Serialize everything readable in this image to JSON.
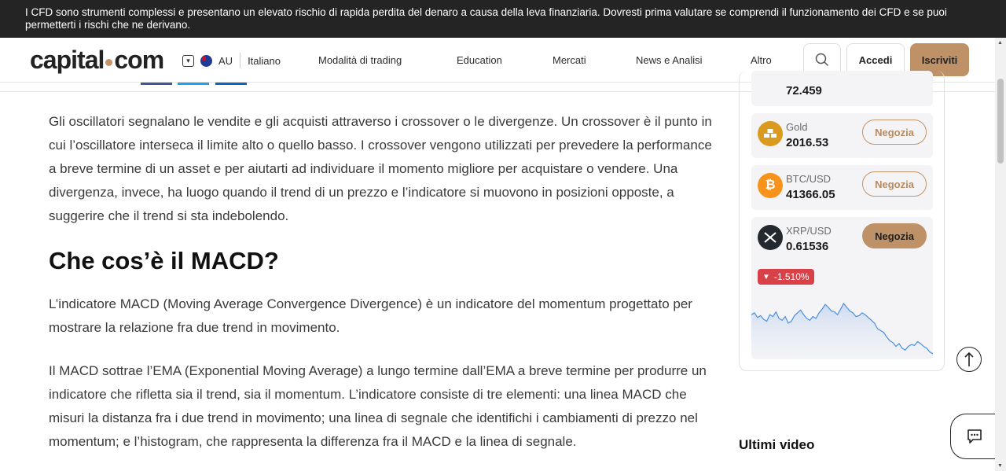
{
  "risk_banner": {
    "text": "I CFD sono strumenti complessi e presentano un elevato rischio di rapida perdita del denaro a causa della leva finanziaria. Dovresti prima valutare se comprendi il funzionamento dei CFD e se puoi permetterti i rischi che ne derivano."
  },
  "header": {
    "logo_left": "capital",
    "logo_right": "com",
    "region_code": "AU",
    "language": "Italiano",
    "nav": [
      "Modalità di trading",
      "Education",
      "Mercati",
      "News e Analisi",
      "Altro"
    ],
    "login_label": "Accedi",
    "signup_label": "Iscriviti"
  },
  "article": {
    "paragraph_1": "Gli oscillatori segnalano le vendite e gli acquisti attraverso i crossover o le divergenze. Un crossover è il punto in cui l’oscillatore interseca il limite alto o quello basso. I crossover vengono utilizzati per prevedere la performance a breve termine di un asset e per aiutarti ad individuare il momento migliore per acquistare o vendere. Una divergenza, invece, ha luogo quando il trend di un prezzo e l’indicatore si muovono in posizioni opposte, a suggerire che il trend si sta indebolendo.",
    "heading": "Che cos’è il MACD?",
    "paragraph_2": "L’indicatore MACD (Moving Average Convergence Divergence) è un indicatore del momentum progettato per mostrare la relazione fra due trend in movimento.",
    "paragraph_3": "Il MACD sottrae l’EMA (Exponential Moving Average) a lungo termine dall’EMA a breve termine per produrre un indicatore che rifletta sia il trend, sia il momentum. L’indicatore consiste di tre elementi: una linea MACD che misuri la distanza fra i due trend in movimento; una linea di segnale che identifichi i cambiamenti di prezzo nel momentum; e l’histogram, che rappresenta la differenza fra il MACD e la linea di segnale."
  },
  "sidebar": {
    "partial_price": "72.459",
    "assets": [
      {
        "name": "Gold",
        "price": "2016.53",
        "trade_label": "Negozia",
        "icon": "gold-bars-icon",
        "color": "#d99a1e"
      },
      {
        "name": "BTC/USD",
        "price": "41366.05",
        "trade_label": "Negozia",
        "icon": "bitcoin-icon",
        "color": "#f7931a"
      },
      {
        "name": "XRP/USD",
        "price": "0.61536",
        "trade_label": "Negozia",
        "icon": "xrp-icon",
        "color": "#23292f",
        "change": "-1.510%"
      }
    ],
    "videos_title": "Ultimi video"
  },
  "colors": {
    "accent": "#bf9167",
    "banner_bg": "#242424",
    "negative": "#d84148",
    "sparkline": "#4a8fe0"
  },
  "sparkline_values": [
    64,
    66,
    61,
    63,
    59,
    57,
    64,
    62,
    67,
    60,
    58,
    62,
    55,
    57,
    63,
    66,
    69,
    64,
    60,
    58,
    62,
    60,
    66,
    70,
    75,
    72,
    68,
    67,
    64,
    70,
    76,
    72,
    68,
    66,
    62,
    63,
    66,
    64,
    61,
    58,
    55,
    49,
    47,
    45,
    40,
    36,
    34,
    30,
    33,
    28,
    26,
    30,
    32,
    31,
    35,
    33,
    30,
    28,
    24,
    22
  ]
}
